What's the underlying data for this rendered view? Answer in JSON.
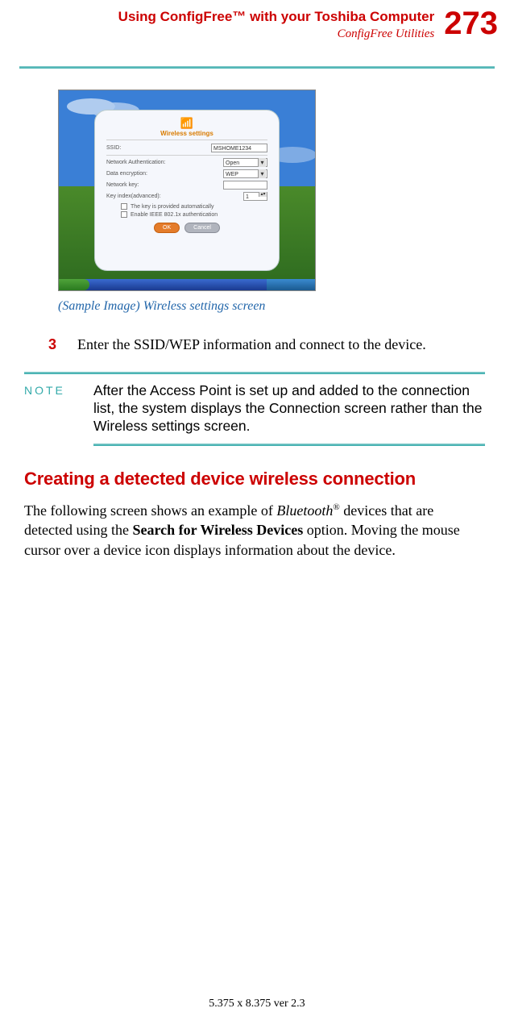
{
  "header": {
    "title": "Using ConfigFree™ with your Toshiba Computer",
    "subtitle": "ConfigFree Utilities",
    "page": "273"
  },
  "screenshot": {
    "panel_title": "Wireless settings",
    "ssid_label": "SSID:",
    "ssid_value": "MSHOME1234",
    "auth_label": "Network Authentication:",
    "auth_value": "Open",
    "enc_label": "Data encryption:",
    "enc_value": "WEP",
    "key_label": "Network key:",
    "key_value": "",
    "index_label": "Key index(advanced):",
    "index_value": "1",
    "cb1": "The key is provided automatically",
    "cb2": "Enable IEEE 802.1x authentication",
    "btn_ok": "OK",
    "btn_cancel": "Cancel"
  },
  "caption": "(Sample Image) Wireless settings screen",
  "step": {
    "num": "3",
    "text": "Enter the SSID/WEP information and connect to the device."
  },
  "note": {
    "label": "NOTE",
    "text": "After the Access Point is set up and added to the connection list, the system displays the Connection screen rather than the Wireless settings screen."
  },
  "section_heading": "Creating a detected device wireless connection",
  "body": {
    "p1_a": "The following screen shows an example of ",
    "p1_b": "Bluetooth",
    "p1_c": " devices that are detected using the ",
    "p1_d": "Search for Wireless Devices",
    "p1_e": " option. Moving the mouse cursor over a device icon displays information about the device."
  },
  "footer": "5.375 x 8.375 ver 2.3"
}
